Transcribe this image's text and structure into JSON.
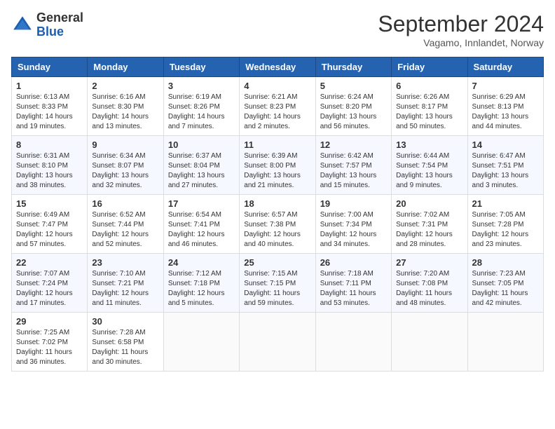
{
  "header": {
    "logo_line1": "General",
    "logo_line2": "Blue",
    "month_year": "September 2024",
    "location": "Vagamo, Innlandet, Norway"
  },
  "weekdays": [
    "Sunday",
    "Monday",
    "Tuesday",
    "Wednesday",
    "Thursday",
    "Friday",
    "Saturday"
  ],
  "weeks": [
    [
      {
        "day": "1",
        "sunrise": "6:13 AM",
        "sunset": "8:33 PM",
        "daylight": "14 hours and 19 minutes."
      },
      {
        "day": "2",
        "sunrise": "6:16 AM",
        "sunset": "8:30 PM",
        "daylight": "14 hours and 13 minutes."
      },
      {
        "day": "3",
        "sunrise": "6:19 AM",
        "sunset": "8:26 PM",
        "daylight": "14 hours and 7 minutes."
      },
      {
        "day": "4",
        "sunrise": "6:21 AM",
        "sunset": "8:23 PM",
        "daylight": "14 hours and 2 minutes."
      },
      {
        "day": "5",
        "sunrise": "6:24 AM",
        "sunset": "8:20 PM",
        "daylight": "13 hours and 56 minutes."
      },
      {
        "day": "6",
        "sunrise": "6:26 AM",
        "sunset": "8:17 PM",
        "daylight": "13 hours and 50 minutes."
      },
      {
        "day": "7",
        "sunrise": "6:29 AM",
        "sunset": "8:13 PM",
        "daylight": "13 hours and 44 minutes."
      }
    ],
    [
      {
        "day": "8",
        "sunrise": "6:31 AM",
        "sunset": "8:10 PM",
        "daylight": "13 hours and 38 minutes."
      },
      {
        "day": "9",
        "sunrise": "6:34 AM",
        "sunset": "8:07 PM",
        "daylight": "13 hours and 32 minutes."
      },
      {
        "day": "10",
        "sunrise": "6:37 AM",
        "sunset": "8:04 PM",
        "daylight": "13 hours and 27 minutes."
      },
      {
        "day": "11",
        "sunrise": "6:39 AM",
        "sunset": "8:00 PM",
        "daylight": "13 hours and 21 minutes."
      },
      {
        "day": "12",
        "sunrise": "6:42 AM",
        "sunset": "7:57 PM",
        "daylight": "13 hours and 15 minutes."
      },
      {
        "day": "13",
        "sunrise": "6:44 AM",
        "sunset": "7:54 PM",
        "daylight": "13 hours and 9 minutes."
      },
      {
        "day": "14",
        "sunrise": "6:47 AM",
        "sunset": "7:51 PM",
        "daylight": "13 hours and 3 minutes."
      }
    ],
    [
      {
        "day": "15",
        "sunrise": "6:49 AM",
        "sunset": "7:47 PM",
        "daylight": "12 hours and 57 minutes."
      },
      {
        "day": "16",
        "sunrise": "6:52 AM",
        "sunset": "7:44 PM",
        "daylight": "12 hours and 52 minutes."
      },
      {
        "day": "17",
        "sunrise": "6:54 AM",
        "sunset": "7:41 PM",
        "daylight": "12 hours and 46 minutes."
      },
      {
        "day": "18",
        "sunrise": "6:57 AM",
        "sunset": "7:38 PM",
        "daylight": "12 hours and 40 minutes."
      },
      {
        "day": "19",
        "sunrise": "7:00 AM",
        "sunset": "7:34 PM",
        "daylight": "12 hours and 34 minutes."
      },
      {
        "day": "20",
        "sunrise": "7:02 AM",
        "sunset": "7:31 PM",
        "daylight": "12 hours and 28 minutes."
      },
      {
        "day": "21",
        "sunrise": "7:05 AM",
        "sunset": "7:28 PM",
        "daylight": "12 hours and 23 minutes."
      }
    ],
    [
      {
        "day": "22",
        "sunrise": "7:07 AM",
        "sunset": "7:24 PM",
        "daylight": "12 hours and 17 minutes."
      },
      {
        "day": "23",
        "sunrise": "7:10 AM",
        "sunset": "7:21 PM",
        "daylight": "12 hours and 11 minutes."
      },
      {
        "day": "24",
        "sunrise": "7:12 AM",
        "sunset": "7:18 PM",
        "daylight": "12 hours and 5 minutes."
      },
      {
        "day": "25",
        "sunrise": "7:15 AM",
        "sunset": "7:15 PM",
        "daylight": "11 hours and 59 minutes."
      },
      {
        "day": "26",
        "sunrise": "7:18 AM",
        "sunset": "7:11 PM",
        "daylight": "11 hours and 53 minutes."
      },
      {
        "day": "27",
        "sunrise": "7:20 AM",
        "sunset": "7:08 PM",
        "daylight": "11 hours and 48 minutes."
      },
      {
        "day": "28",
        "sunrise": "7:23 AM",
        "sunset": "7:05 PM",
        "daylight": "11 hours and 42 minutes."
      }
    ],
    [
      {
        "day": "29",
        "sunrise": "7:25 AM",
        "sunset": "7:02 PM",
        "daylight": "11 hours and 36 minutes."
      },
      {
        "day": "30",
        "sunrise": "7:28 AM",
        "sunset": "6:58 PM",
        "daylight": "11 hours and 30 minutes."
      },
      null,
      null,
      null,
      null,
      null
    ]
  ],
  "labels": {
    "sunrise": "Sunrise:",
    "sunset": "Sunset:",
    "daylight": "Daylight:"
  }
}
